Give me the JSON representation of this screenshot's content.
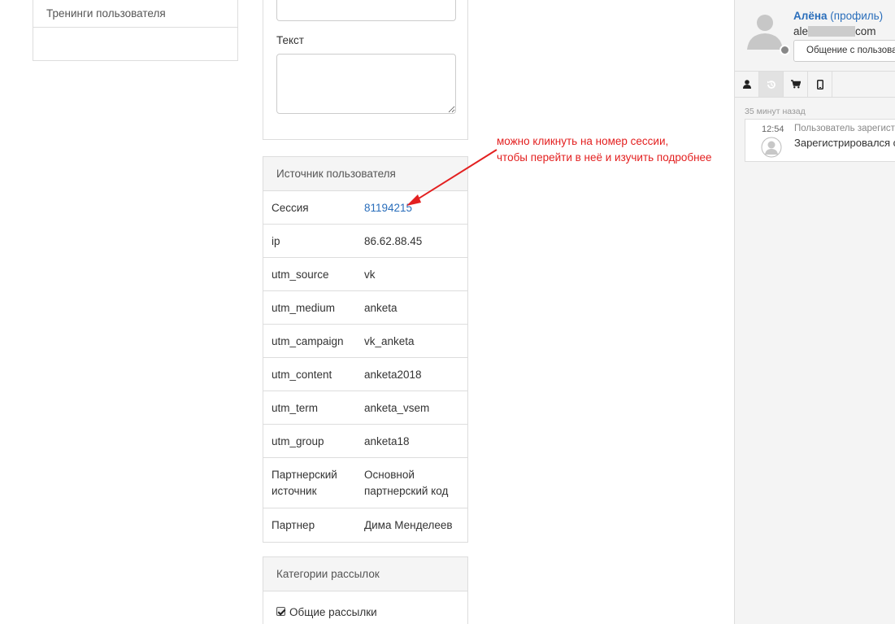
{
  "left_panel": {
    "trainings_label": "Тренинги пользователя"
  },
  "form": {
    "text_label": "Текст"
  },
  "source": {
    "title": "Источник пользователя",
    "rows": [
      {
        "key": "Сессия",
        "value": "81194215"
      },
      {
        "key": "ip",
        "value": "86.62.88.45"
      },
      {
        "key": "utm_source",
        "value": "vk"
      },
      {
        "key": "utm_medium",
        "value": "anketa"
      },
      {
        "key": "utm_campaign",
        "value": "vk_anketa"
      },
      {
        "key": "utm_content",
        "value": "anketa2018"
      },
      {
        "key": "utm_term",
        "value": "anketa_vsem"
      },
      {
        "key": "utm_group",
        "value": "anketa18"
      },
      {
        "key": "Партнерский источник",
        "value": "Основной партнерский код"
      },
      {
        "key": "Партнер",
        "value": "Дима Менделеев"
      }
    ]
  },
  "mailing": {
    "title": "Категории рассылок",
    "items": [
      {
        "label": "Общие рассылки",
        "checked": true
      }
    ]
  },
  "annotation": {
    "line1": "можно кликнуть на номер сессии,",
    "line2": "чтобы перейти в неё и изучить подробнее",
    "color": "#e32020"
  },
  "sidebar": {
    "user_name": "Алёна",
    "profile_link": "(профиль)",
    "email_prefix": "ale",
    "email_suffix": "com",
    "chat_button": "Общение с пользователем",
    "tabs": [
      "user-icon",
      "history-icon",
      "cart-icon",
      "mobile-icon"
    ],
    "active_tab": 1,
    "time_ago": "35 минут назад",
    "event": {
      "time": "12:54",
      "title": "Пользователь зарегистрировался",
      "text": "Зарегистрировался с"
    }
  },
  "colors": {
    "link": "#2a6ebb",
    "border": "#dddddd",
    "header_bg": "#f5f5f5"
  }
}
